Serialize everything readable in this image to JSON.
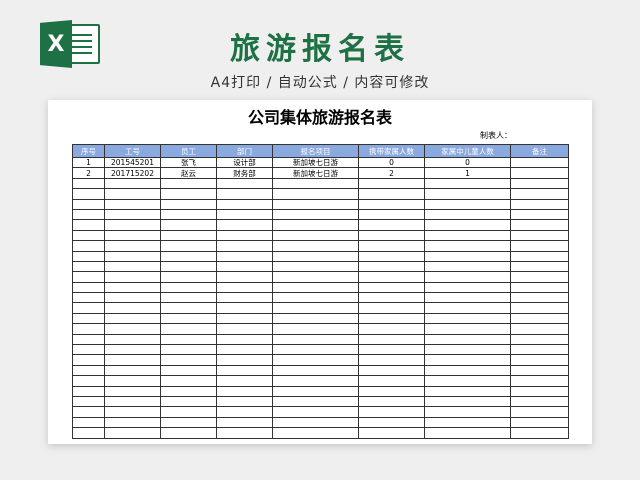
{
  "banner": {
    "title": "旅游报名表",
    "subtitle": "A4打印 / 自动公式 / 内容可修改",
    "logo_letter": "X"
  },
  "sheet": {
    "title": "公司集体旅游报名表",
    "maker_label": "制表人：",
    "columns": [
      "序号",
      "工号",
      "员工",
      "部门",
      "报名项目",
      "携带家属人数",
      "家属中儿童人数",
      "备注"
    ],
    "rows": [
      [
        "1",
        "201545201",
        "张飞",
        "设计部",
        "新加坡七日游",
        "0",
        "0",
        ""
      ],
      [
        "2",
        "201715202",
        "赵云",
        "财务部",
        "新加坡七日游",
        "2",
        "1",
        ""
      ]
    ],
    "empty_rows": 25
  },
  "colors": {
    "brand": "#1e7145",
    "header_bg": "#8aa9df"
  }
}
